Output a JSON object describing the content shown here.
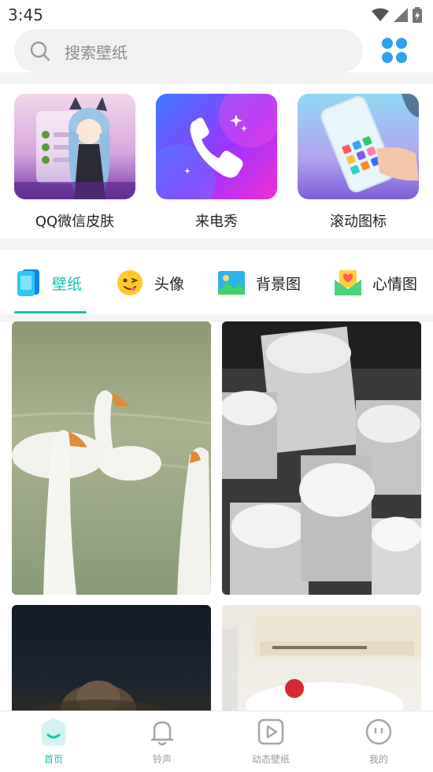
{
  "status_bar": {
    "time": "3:45",
    "icons": [
      "wifi-icon",
      "signal-icon",
      "battery-icon"
    ]
  },
  "search": {
    "placeholder": "搜索壁纸",
    "icon": "search-icon"
  },
  "header": {
    "apps_icon": "apps-grid-icon"
  },
  "features": [
    {
      "label": "QQ微信皮肤"
    },
    {
      "label": "来电秀"
    },
    {
      "label": "滚动图标"
    }
  ],
  "tabs": [
    {
      "label": "壁纸",
      "icon": "phone-wallpaper-icon"
    },
    {
      "label": "头像",
      "icon": "smiley-face-icon"
    },
    {
      "label": "背景图",
      "icon": "landscape-image-icon"
    },
    {
      "label": "心情图",
      "icon": "heart-envelope-icon"
    }
  ],
  "active_tab": "壁纸",
  "bottom_nav": [
    {
      "label": "首页",
      "icon": "home-icon"
    },
    {
      "label": "铃声",
      "icon": "bell-icon"
    },
    {
      "label": "动态壁纸",
      "icon": "play-icon"
    },
    {
      "label": "我的",
      "icon": "profile-icon"
    }
  ],
  "colors": {
    "accent": "#13c2b1",
    "inactive": "#999999"
  }
}
